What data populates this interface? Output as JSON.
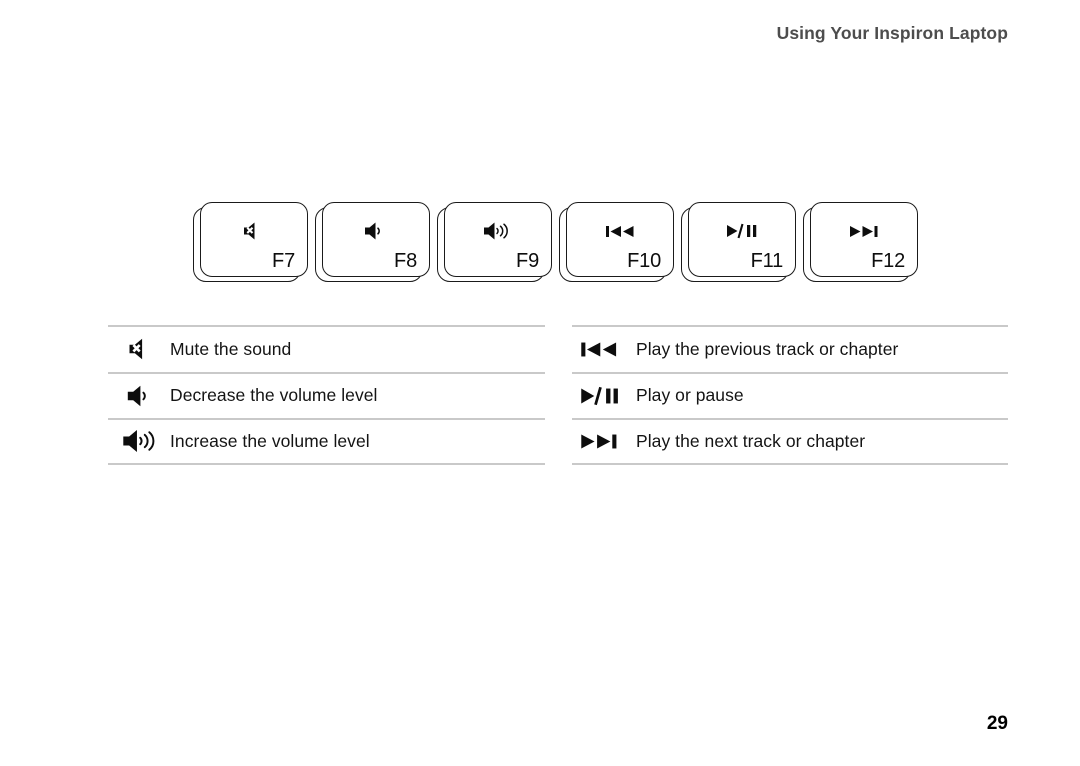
{
  "header": {
    "title": "Using Your Inspiron Laptop"
  },
  "keys": [
    {
      "label": "F7",
      "icon": "mute-icon"
    },
    {
      "label": "F8",
      "icon": "volume-down-icon"
    },
    {
      "label": "F9",
      "icon": "volume-up-icon"
    },
    {
      "label": "F10",
      "icon": "previous-track-icon"
    },
    {
      "label": "F11",
      "icon": "play-pause-icon"
    },
    {
      "label": "F12",
      "icon": "next-track-icon"
    }
  ],
  "legend_left": [
    {
      "icon": "mute-icon",
      "text": "Mute the sound"
    },
    {
      "icon": "volume-down-icon",
      "text": "Decrease the volume level"
    },
    {
      "icon": "volume-up-icon",
      "text": "Increase the volume level"
    }
  ],
  "legend_right": [
    {
      "icon": "previous-track-icon",
      "text": "Play the previous track or chapter"
    },
    {
      "icon": "play-pause-icon",
      "text": "Play or pause"
    },
    {
      "icon": "next-track-icon",
      "text": "Play the next track or chapter"
    }
  ],
  "footer": {
    "page_number": "29"
  },
  "colors": {
    "header_text": "#4d4d4d",
    "body_text": "#141414",
    "rule": "#c9c9c9",
    "ink": "#0d0d0d",
    "page_background": "#ffffff"
  }
}
